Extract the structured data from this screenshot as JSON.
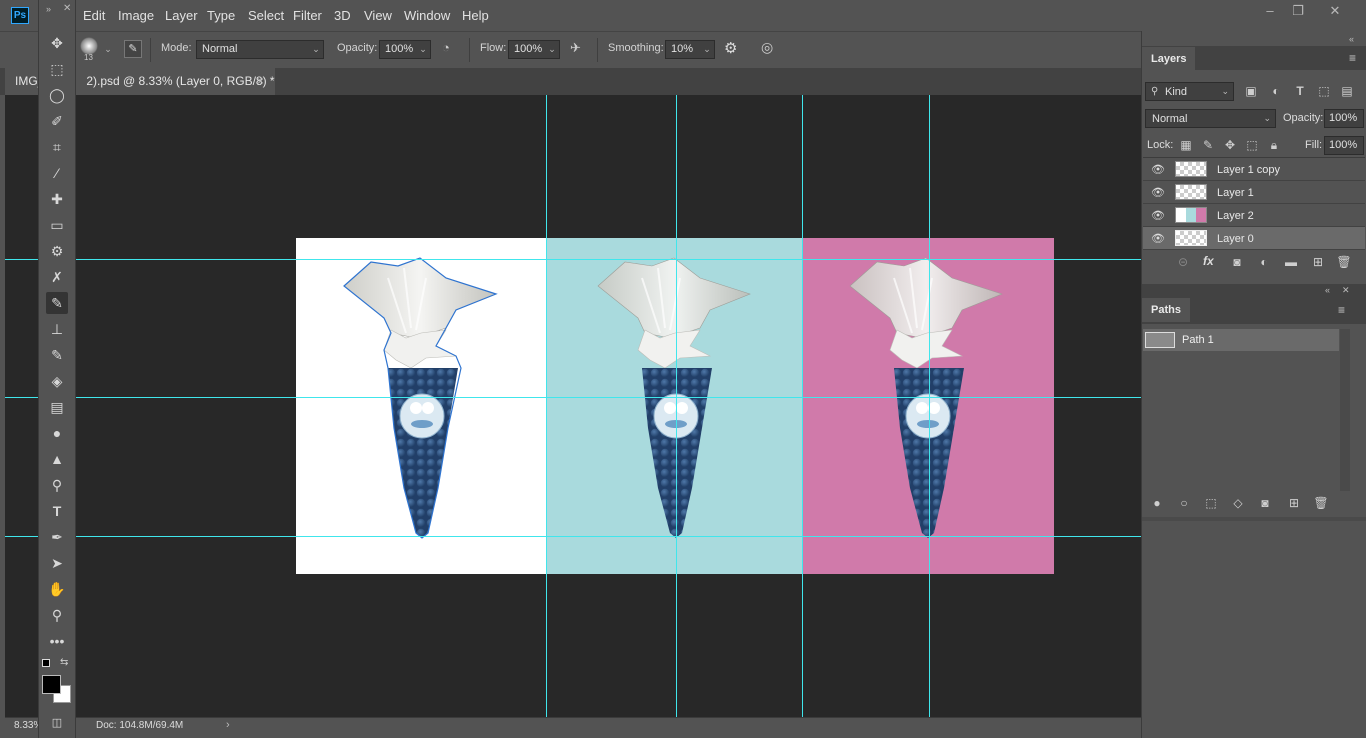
{
  "menubar": {
    "logo": "Ps",
    "items": [
      "Edit",
      "Image",
      "Layer",
      "Type",
      "Select",
      "Filter",
      "3D",
      "View",
      "Window",
      "Help"
    ],
    "window_controls": [
      "–",
      "❐",
      "✕"
    ]
  },
  "options": {
    "brush_size": "13",
    "mode_label": "Mode:",
    "mode_value": "Normal",
    "opacity_label": "Opacity:",
    "opacity_value": "100%",
    "flow_label": "Flow:",
    "flow_value": "100%",
    "smoothing_label": "Smoothing:",
    "smoothing_value": "10%"
  },
  "document": {
    "tab_title": "IMG_",
    "tab_title_rest": "2).psd @ 8.33% (Layer 0, RGB/8) *",
    "close": "×"
  },
  "status": {
    "zoom": "8.33%",
    "doc": "Doc: 104.8M/69.4M"
  },
  "layers_panel": {
    "title": "Layers",
    "filter_kind": "Kind",
    "blend_mode": "Normal",
    "opacity_label": "Opacity:",
    "opacity_value": "100%",
    "lock_label": "Lock:",
    "fill_label": "Fill:",
    "fill_value": "100%",
    "layers": [
      {
        "name": "Layer 1 copy"
      },
      {
        "name": "Layer 1"
      },
      {
        "name": "Layer 2"
      },
      {
        "name": "Layer 0"
      }
    ],
    "footer_fx": "fx"
  },
  "paths_panel": {
    "title": "Paths",
    "paths": [
      {
        "name": "Path 1"
      }
    ]
  },
  "colors": {
    "canvas_bg": "#282828",
    "guide": "#40e6ec",
    "panel_teal": "#a9dadd",
    "panel_pink": "#d07aaa",
    "candy_blue": "#2b4f7e"
  },
  "tool_icons": [
    "move-icon",
    "marquee-icon",
    "lasso-icon",
    "quick-select-icon",
    "crop-icon",
    "eyedropper-icon",
    "healing-icon",
    "bandage-icon",
    "patch-icon",
    "content-aware-move-icon",
    "brush-icon",
    "stamp-icon",
    "history-brush-icon",
    "eraser-icon",
    "gradient-icon",
    "blur-icon",
    "sharpen-icon",
    "dodge-icon",
    "type-icon",
    "pen-icon",
    "path-select-icon",
    "hand-icon",
    "zoom-icon",
    "more-icon"
  ]
}
